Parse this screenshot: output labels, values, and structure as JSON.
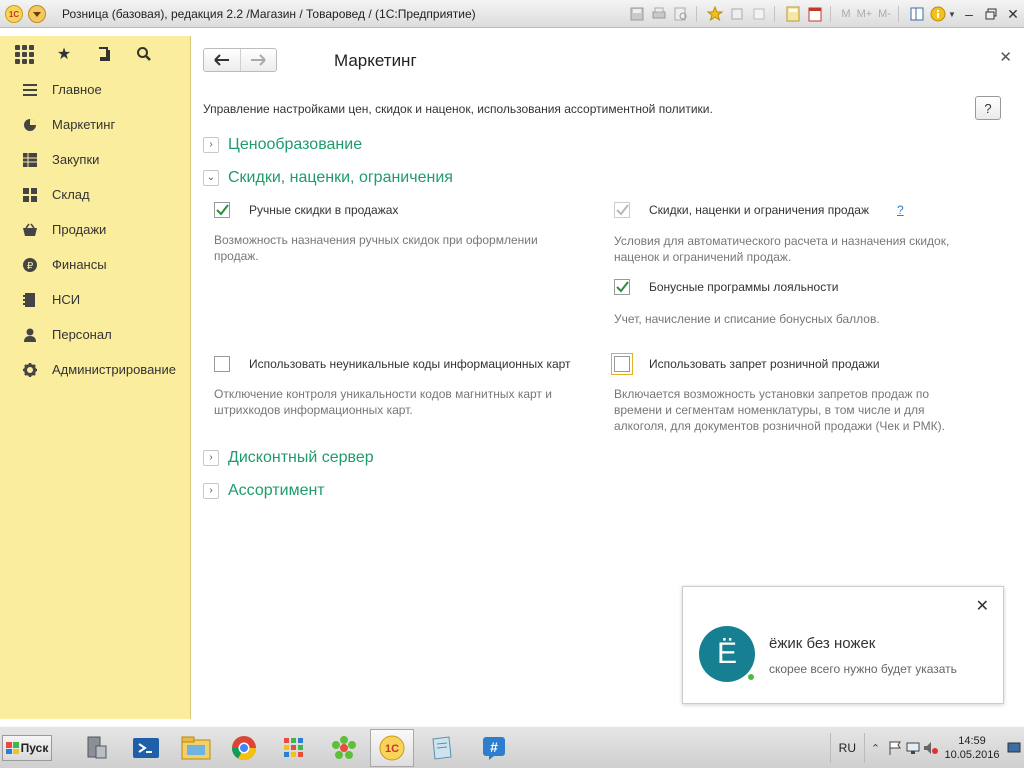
{
  "window": {
    "title": "Розница (базовая), редакция 2.2 /Магазин / Товаровед /  (1С:Предприятие)",
    "logo_text": "1С",
    "memory_buttons": [
      "M",
      "M+",
      "M-"
    ]
  },
  "sidebar": {
    "items": [
      {
        "label": "Главное",
        "icon": "list-icon"
      },
      {
        "label": "Маркетинг",
        "icon": "pie-chart-icon"
      },
      {
        "label": "Закупки",
        "icon": "table-icon"
      },
      {
        "label": "Склад",
        "icon": "warehouse-icon"
      },
      {
        "label": "Продажи",
        "icon": "basket-icon"
      },
      {
        "label": "Финансы",
        "icon": "ruble-icon"
      },
      {
        "label": "НСИ",
        "icon": "book-icon"
      },
      {
        "label": "Персонал",
        "icon": "person-icon"
      },
      {
        "label": "Администрирование",
        "icon": "gear-icon"
      }
    ]
  },
  "main": {
    "title": "Маркетинг",
    "description": "Управление настройками цен, скидок и наценок, использования ассортиментной политики.",
    "help_label": "?",
    "groups": {
      "pricing": "Ценообразование",
      "discounts": "Скидки, наценки, ограничения",
      "discount_server": "Дисконтный сервер",
      "assortment": "Ассортимент"
    },
    "options": {
      "manual_discounts": {
        "label": "Ручные скидки в продажах",
        "checked": true,
        "hint_line1": "Возможность назначения ручных скидок при оформлении",
        "hint_line2": "продаж."
      },
      "auto_discounts": {
        "label": "Скидки, наценки и ограничения продаж",
        "checked": true,
        "disabled": true,
        "help_link": "?",
        "hint_line1": "Условия для автоматического расчета и назначения скидок,",
        "hint_line2": "наценок и ограничений продаж."
      },
      "bonus_programs": {
        "label": "Бонусные программы лояльности",
        "checked": true,
        "hint_line1": "Учет, начисление и списание бонусных баллов."
      },
      "nonunique_codes": {
        "label": "Использовать неуникальные коды информационных карт",
        "checked": false,
        "hint_line1": "Отключение контроля уникальности кодов магнитных карт и",
        "hint_line2": "штрихкодов информационных карт."
      },
      "sales_ban": {
        "label": "Использовать запрет розничной продажи",
        "checked": false,
        "hint_line1": "Включается возможность установки запретов продаж по",
        "hint_line2": "времени и сегментам номенклатуры, в том числе и для",
        "hint_line3": "алкоголя, для документов розничной продажи (Чек и РМК)."
      }
    }
  },
  "notification": {
    "avatar_letter": "Ё",
    "name": "ёжик без ножек",
    "text": "скорее всего нужно будет указать"
  },
  "taskbar": {
    "start_label": "Пуск",
    "language": "RU",
    "time": "14:59",
    "date": "10.05.2016"
  },
  "colors": {
    "sidebar_bg": "#fbed9e",
    "group_green": "#1f9c6b",
    "check_green": "#2e8b3d",
    "avatar_teal": "#167f92",
    "status_green": "#4cbb3c"
  }
}
